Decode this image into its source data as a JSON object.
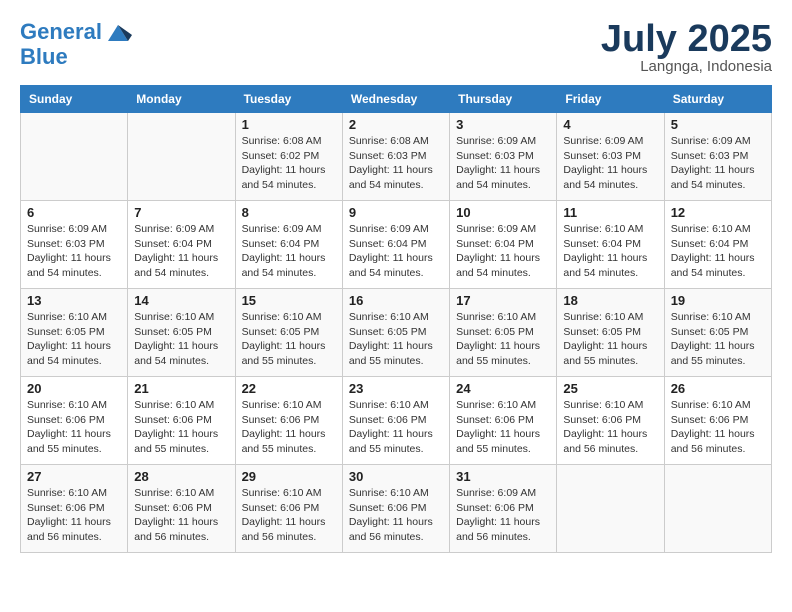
{
  "header": {
    "logo_line1": "General",
    "logo_line2": "Blue",
    "month_year": "July 2025",
    "location": "Langnga, Indonesia"
  },
  "days_of_week": [
    "Sunday",
    "Monday",
    "Tuesday",
    "Wednesday",
    "Thursday",
    "Friday",
    "Saturday"
  ],
  "weeks": [
    [
      {
        "day": "",
        "detail": ""
      },
      {
        "day": "",
        "detail": ""
      },
      {
        "day": "1",
        "detail": "Sunrise: 6:08 AM\nSunset: 6:02 PM\nDaylight: 11 hours and 54 minutes."
      },
      {
        "day": "2",
        "detail": "Sunrise: 6:08 AM\nSunset: 6:03 PM\nDaylight: 11 hours and 54 minutes."
      },
      {
        "day": "3",
        "detail": "Sunrise: 6:09 AM\nSunset: 6:03 PM\nDaylight: 11 hours and 54 minutes."
      },
      {
        "day": "4",
        "detail": "Sunrise: 6:09 AM\nSunset: 6:03 PM\nDaylight: 11 hours and 54 minutes."
      },
      {
        "day": "5",
        "detail": "Sunrise: 6:09 AM\nSunset: 6:03 PM\nDaylight: 11 hours and 54 minutes."
      }
    ],
    [
      {
        "day": "6",
        "detail": "Sunrise: 6:09 AM\nSunset: 6:03 PM\nDaylight: 11 hours and 54 minutes."
      },
      {
        "day": "7",
        "detail": "Sunrise: 6:09 AM\nSunset: 6:04 PM\nDaylight: 11 hours and 54 minutes."
      },
      {
        "day": "8",
        "detail": "Sunrise: 6:09 AM\nSunset: 6:04 PM\nDaylight: 11 hours and 54 minutes."
      },
      {
        "day": "9",
        "detail": "Sunrise: 6:09 AM\nSunset: 6:04 PM\nDaylight: 11 hours and 54 minutes."
      },
      {
        "day": "10",
        "detail": "Sunrise: 6:09 AM\nSunset: 6:04 PM\nDaylight: 11 hours and 54 minutes."
      },
      {
        "day": "11",
        "detail": "Sunrise: 6:10 AM\nSunset: 6:04 PM\nDaylight: 11 hours and 54 minutes."
      },
      {
        "day": "12",
        "detail": "Sunrise: 6:10 AM\nSunset: 6:04 PM\nDaylight: 11 hours and 54 minutes."
      }
    ],
    [
      {
        "day": "13",
        "detail": "Sunrise: 6:10 AM\nSunset: 6:05 PM\nDaylight: 11 hours and 54 minutes."
      },
      {
        "day": "14",
        "detail": "Sunrise: 6:10 AM\nSunset: 6:05 PM\nDaylight: 11 hours and 54 minutes."
      },
      {
        "day": "15",
        "detail": "Sunrise: 6:10 AM\nSunset: 6:05 PM\nDaylight: 11 hours and 55 minutes."
      },
      {
        "day": "16",
        "detail": "Sunrise: 6:10 AM\nSunset: 6:05 PM\nDaylight: 11 hours and 55 minutes."
      },
      {
        "day": "17",
        "detail": "Sunrise: 6:10 AM\nSunset: 6:05 PM\nDaylight: 11 hours and 55 minutes."
      },
      {
        "day": "18",
        "detail": "Sunrise: 6:10 AM\nSunset: 6:05 PM\nDaylight: 11 hours and 55 minutes."
      },
      {
        "day": "19",
        "detail": "Sunrise: 6:10 AM\nSunset: 6:05 PM\nDaylight: 11 hours and 55 minutes."
      }
    ],
    [
      {
        "day": "20",
        "detail": "Sunrise: 6:10 AM\nSunset: 6:06 PM\nDaylight: 11 hours and 55 minutes."
      },
      {
        "day": "21",
        "detail": "Sunrise: 6:10 AM\nSunset: 6:06 PM\nDaylight: 11 hours and 55 minutes."
      },
      {
        "day": "22",
        "detail": "Sunrise: 6:10 AM\nSunset: 6:06 PM\nDaylight: 11 hours and 55 minutes."
      },
      {
        "day": "23",
        "detail": "Sunrise: 6:10 AM\nSunset: 6:06 PM\nDaylight: 11 hours and 55 minutes."
      },
      {
        "day": "24",
        "detail": "Sunrise: 6:10 AM\nSunset: 6:06 PM\nDaylight: 11 hours and 55 minutes."
      },
      {
        "day": "25",
        "detail": "Sunrise: 6:10 AM\nSunset: 6:06 PM\nDaylight: 11 hours and 56 minutes."
      },
      {
        "day": "26",
        "detail": "Sunrise: 6:10 AM\nSunset: 6:06 PM\nDaylight: 11 hours and 56 minutes."
      }
    ],
    [
      {
        "day": "27",
        "detail": "Sunrise: 6:10 AM\nSunset: 6:06 PM\nDaylight: 11 hours and 56 minutes."
      },
      {
        "day": "28",
        "detail": "Sunrise: 6:10 AM\nSunset: 6:06 PM\nDaylight: 11 hours and 56 minutes."
      },
      {
        "day": "29",
        "detail": "Sunrise: 6:10 AM\nSunset: 6:06 PM\nDaylight: 11 hours and 56 minutes."
      },
      {
        "day": "30",
        "detail": "Sunrise: 6:10 AM\nSunset: 6:06 PM\nDaylight: 11 hours and 56 minutes."
      },
      {
        "day": "31",
        "detail": "Sunrise: 6:09 AM\nSunset: 6:06 PM\nDaylight: 11 hours and 56 minutes."
      },
      {
        "day": "",
        "detail": ""
      },
      {
        "day": "",
        "detail": ""
      }
    ]
  ]
}
